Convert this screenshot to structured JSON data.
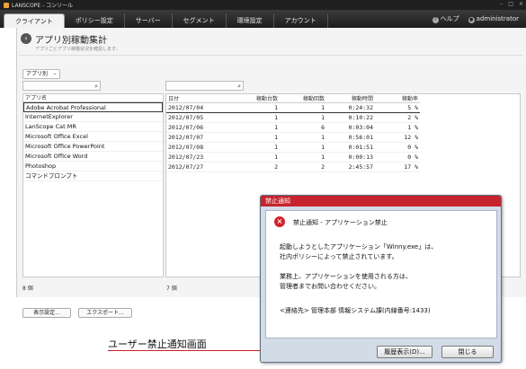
{
  "window": {
    "title": "LANSCOPE - コンソール"
  },
  "menu": {
    "tabs": [
      {
        "label": "クライアント"
      },
      {
        "label": "ポリシー設定"
      },
      {
        "label": "サーバー"
      },
      {
        "label": "セグメント"
      },
      {
        "label": "環境設定"
      },
      {
        "label": "アカウント"
      }
    ],
    "help_label": "ヘルプ",
    "user_label": "administrator"
  },
  "page": {
    "title": "アプリ別稼動集計",
    "subtitle": "アプリごとアプリ稼働状況を確認します。",
    "filter_value": "アプリ別"
  },
  "app_list": {
    "header": "アプリ名",
    "items": [
      "Adobe Acrobat Professional",
      "InternetExplorer",
      "LanScope Cat MR",
      "Microsoft Office Excel",
      "Microsoft Office PowerPoint",
      "Microsoft Office Word",
      "Photoshop",
      "コマンドプロンプト"
    ],
    "count": "8 個"
  },
  "usage_table": {
    "headers": [
      "日付",
      "稼動台数",
      "稼動回数",
      "稼動時間",
      "稼動率"
    ],
    "rows": [
      [
        "2012/07/04",
        "1",
        "1",
        "0:24:32",
        "5 %"
      ],
      [
        "2012/07/05",
        "1",
        "1",
        "0:10:22",
        "2 %"
      ],
      [
        "2012/07/06",
        "1",
        "6",
        "0:03:04",
        "1 %"
      ],
      [
        "2012/07/07",
        "1",
        "1",
        "0:56:01",
        "12 %"
      ],
      [
        "2012/07/08",
        "1",
        "1",
        "0:01:51",
        "0 %"
      ],
      [
        "2012/07/23",
        "1",
        "1",
        "0:00:13",
        "0 %"
      ],
      [
        "2012/07/27",
        "2",
        "2",
        "2:45:57",
        "17 %"
      ]
    ],
    "count": "7 個"
  },
  "footer": {
    "display_settings": "表示設定...",
    "export": "エクスポート..."
  },
  "dialog": {
    "title": "禁止通知",
    "heading": "禁止通知 - アプリケーション禁止",
    "line1": "起動しようとしたアプリケーション「Winny.exe」は、",
    "line2": "社内ポリシーによって禁止されています。",
    "line3": "業務上、アプリケーションを使用される方は、",
    "line4": "管理者までお問い合わせください。",
    "contact": "<連絡先> 管理本部 情報システム課(内線番号:1433)",
    "history_button": "履歴表示(D)...",
    "close_button": "閉じる",
    "title_color": "#c7232d"
  },
  "caption": {
    "text": "ユーザー禁止通知画面"
  }
}
